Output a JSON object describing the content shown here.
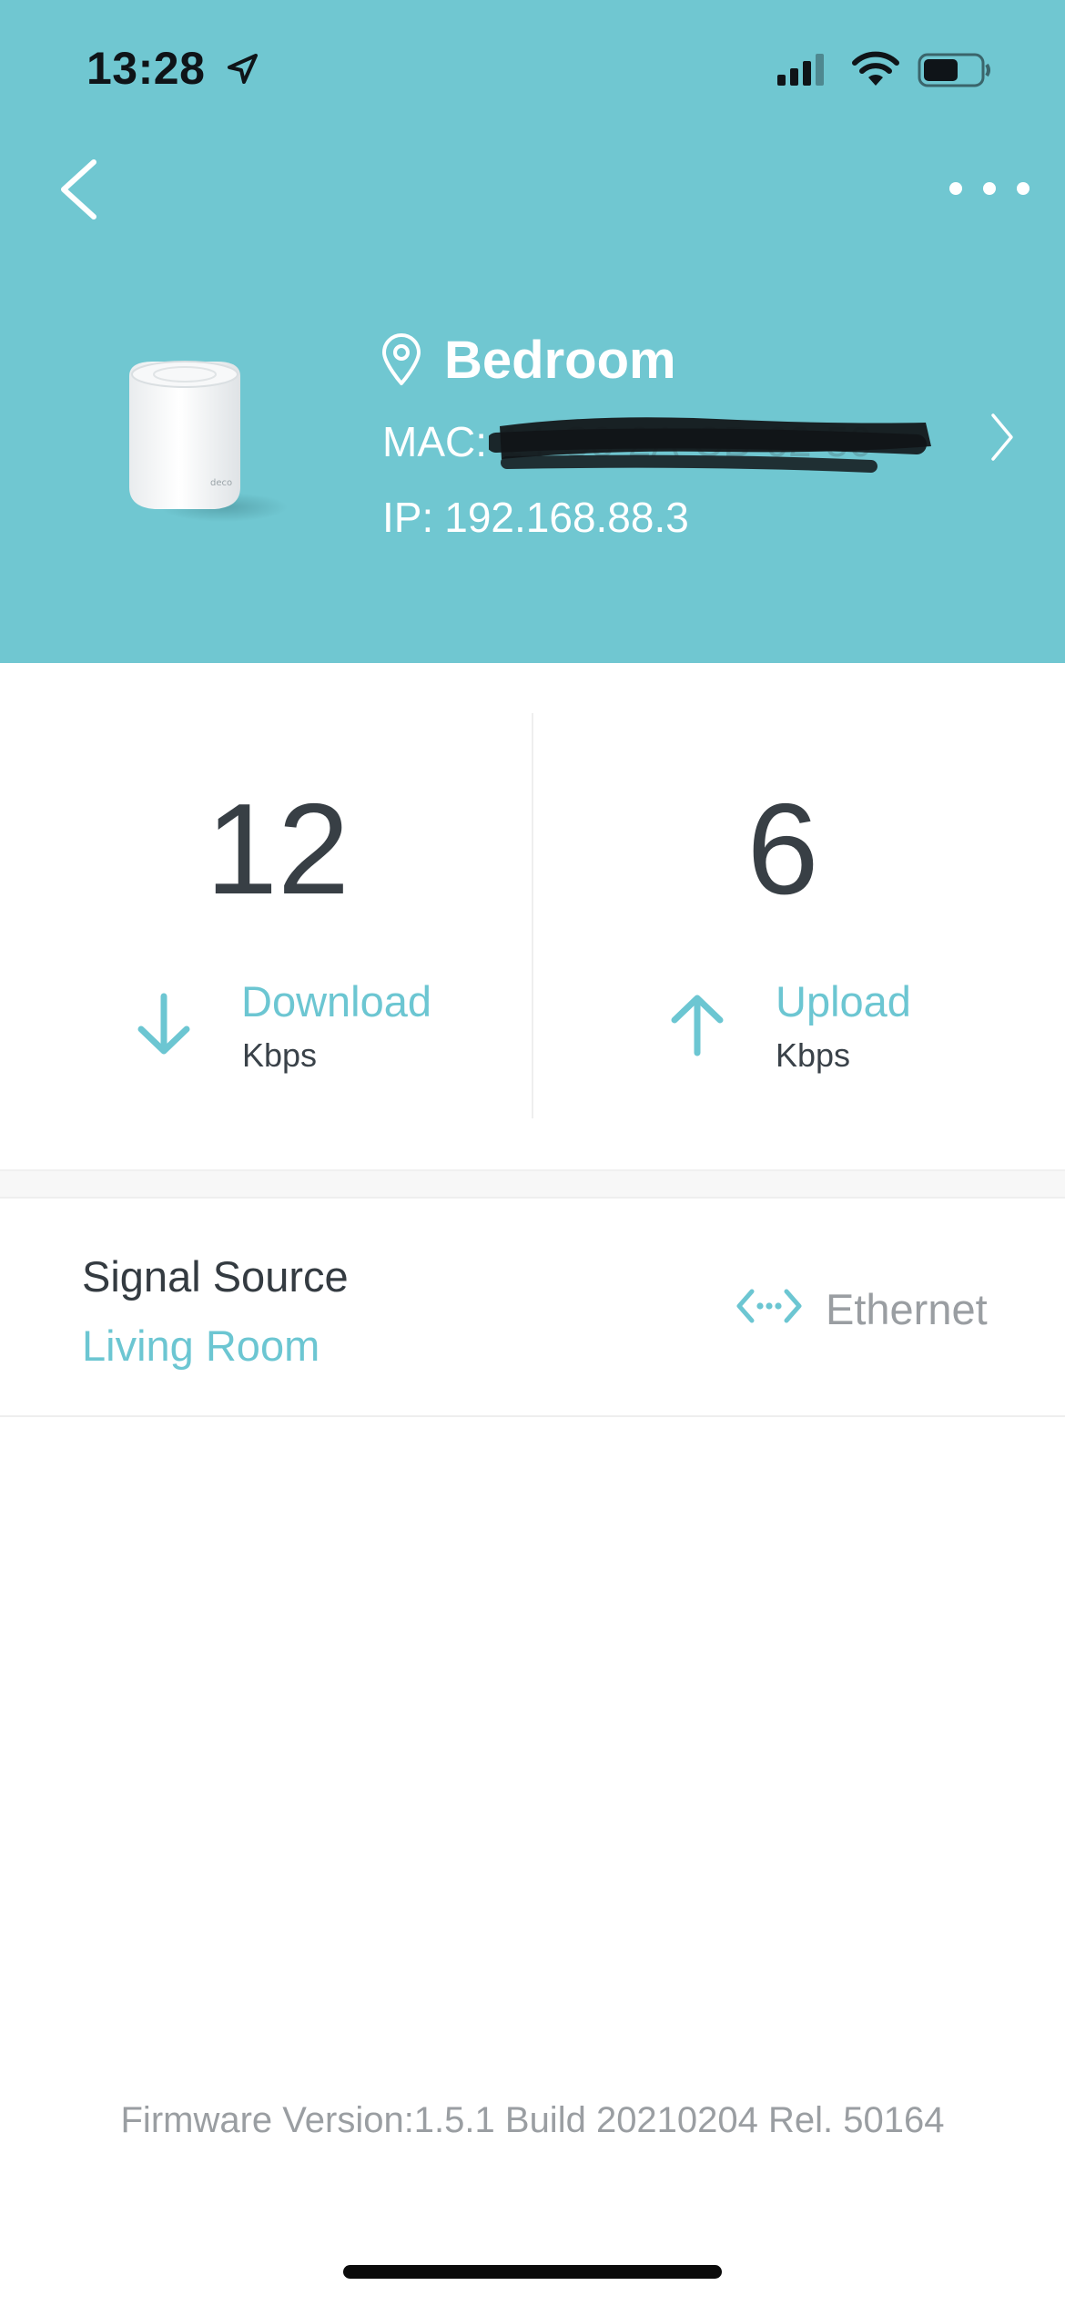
{
  "status_bar": {
    "time": "13:28",
    "icons": [
      "location-arrow-icon",
      "cellular-signal-icon",
      "wifi-icon",
      "battery-icon"
    ]
  },
  "nav": {
    "back_icon": "chevron-left-icon",
    "more_icon": "ellipsis-icon"
  },
  "device": {
    "name": "Bedroom",
    "mac_label": "MAC:",
    "mac_value": "14-C3-2A-CB-62-50",
    "mac_redacted": true,
    "ip_label": "IP:",
    "ip_value": "192.168.88.3",
    "image": "mesh-router-unit"
  },
  "speeds": {
    "download": {
      "value": "12",
      "label": "Download",
      "unit": "Kbps"
    },
    "upload": {
      "value": "6",
      "label": "Upload",
      "unit": "Kbps"
    }
  },
  "signal_source": {
    "title": "Signal Source",
    "value": "Living Room",
    "connection_type": "Ethernet",
    "connection_icon": "ethernet-link-icon"
  },
  "firmware": "Firmware Version:1.5.1 Build 20210204 Rel. 50164",
  "colors": {
    "header_bg": "#70c7d1",
    "accent": "#6cc6d2",
    "text_dark": "#383f45",
    "text_muted": "#9a9ea2"
  }
}
